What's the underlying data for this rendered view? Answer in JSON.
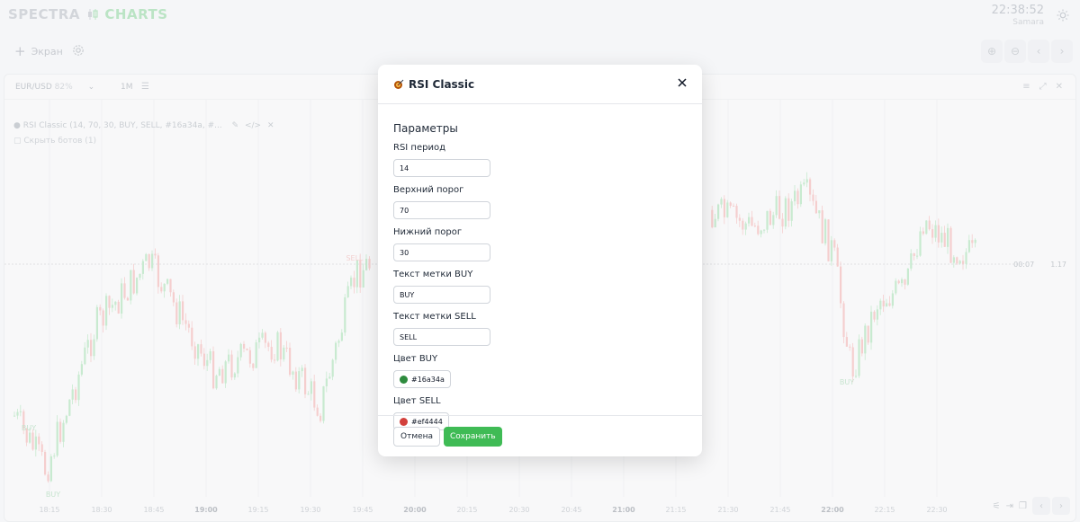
{
  "app": {
    "logo_part1": "SPECTRA",
    "logo_part2": "CHARTS",
    "time": "22:38:52",
    "city": "Samara"
  },
  "toolbar": {
    "screen_label": "Экран"
  },
  "chart_panel": {
    "pair": "EUR/USD",
    "pair_pct": "82%",
    "timeframe": "1M",
    "indicator_line": "RSI Classic (14, 70, 30, BUY, SELL, #16a34a, #...",
    "hide_bots": "Скрыть ботов (1)",
    "countdown": "00:07",
    "price": "1.17",
    "markers": {
      "buy": "BUY",
      "sell": "SELL"
    },
    "x_labels": [
      "18:15",
      "18:30",
      "18:45",
      "19:00",
      "19:15",
      "19:30",
      "19:45",
      "20:00",
      "20:15",
      "20:30",
      "20:45",
      "21:00",
      "21:15",
      "21:30",
      "21:45",
      "22:00",
      "22:15",
      "22:30"
    ],
    "x_labels_bold": [
      "19:00",
      "20:00",
      "21:00",
      "22:00"
    ],
    "up_color": "#16a34a",
    "down_color": "#ef4444"
  },
  "modal": {
    "title": "RSI Classic",
    "section": "Параметры",
    "fields": [
      {
        "label": "RSI период",
        "value": "14"
      },
      {
        "label": "Верхний порог",
        "value": "70"
      },
      {
        "label": "Нижний порог",
        "value": "30"
      },
      {
        "label": "Текст метки BUY",
        "value": "BUY"
      },
      {
        "label": "Текст метки SELL",
        "value": "SELL"
      }
    ],
    "colors": [
      {
        "label": "Цвет BUY",
        "value": "#16a34a"
      },
      {
        "label": "Цвет SELL",
        "value": "#ef4444"
      }
    ],
    "cancel_label": "Отмена",
    "save_label": "Сохранить"
  }
}
